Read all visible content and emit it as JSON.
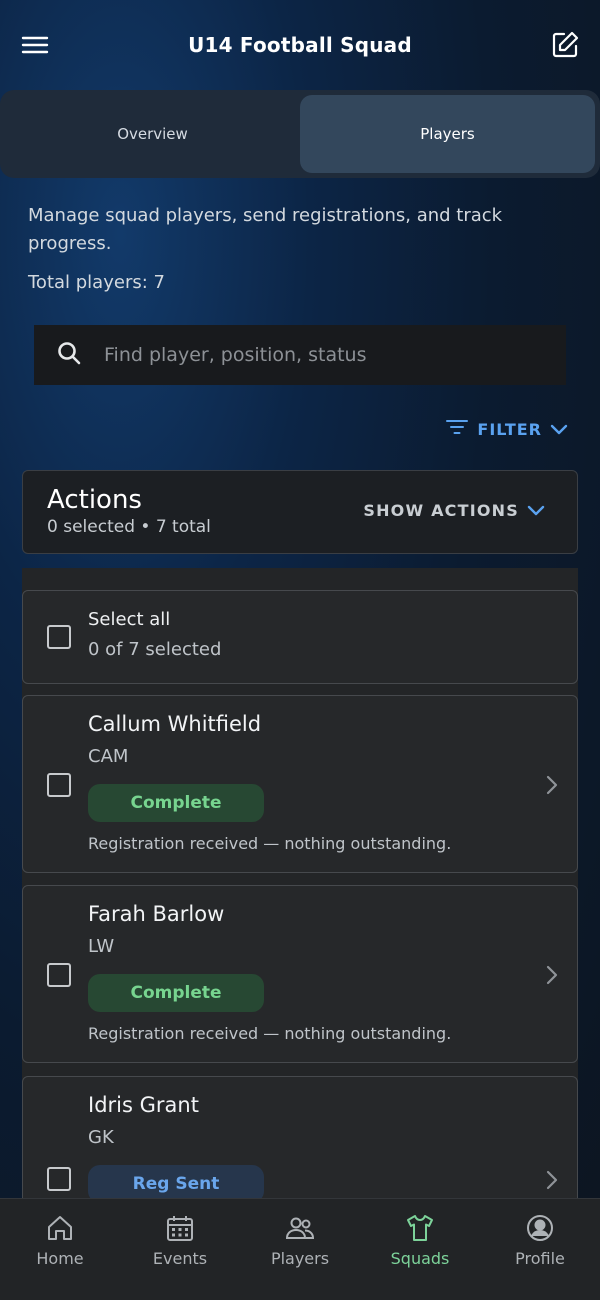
{
  "header": {
    "title": "U14 Football Squad",
    "menu_icon": "hamburger-menu-icon",
    "edit_icon": "edit-icon"
  },
  "tabs": [
    {
      "label": "Overview",
      "active": false
    },
    {
      "label": "Players",
      "active": true
    }
  ],
  "intro": {
    "description": "Manage squad players, send registrations, and track progress.",
    "total": "Total players: 7"
  },
  "search": {
    "placeholder": "Find player, position, status",
    "value": ""
  },
  "filter": {
    "label": "FILTER"
  },
  "actions": {
    "title": "Actions",
    "summary": "0 selected • 7 total",
    "toggle_label": "SHOW ACTIONS"
  },
  "select_all": {
    "label": "Select all",
    "summary": "0 of 7 selected",
    "checked": false
  },
  "players": [
    {
      "name": "Callum Whitfield",
      "position": "CAM",
      "status": "Complete",
      "status_type": "complete",
      "note": "Registration received — nothing outstanding."
    },
    {
      "name": "Farah Barlow",
      "position": "LW",
      "status": "Complete",
      "status_type": "complete",
      "note": "Registration received — nothing outstanding."
    },
    {
      "name": "Idris Grant",
      "position": "GK",
      "status": "Reg Sent",
      "status_type": "sent",
      "note": ""
    }
  ],
  "bottom_nav": [
    {
      "label": "Home",
      "icon": "home-icon",
      "active": false
    },
    {
      "label": "Events",
      "icon": "calendar-icon",
      "active": false
    },
    {
      "label": "Players",
      "icon": "people-icon",
      "active": false
    },
    {
      "label": "Squads",
      "icon": "shirt-icon",
      "active": true
    },
    {
      "label": "Profile",
      "icon": "profile-icon",
      "active": false
    }
  ],
  "colors": {
    "accent_blue": "#5aa2f0",
    "accent_green": "#7dd39a",
    "complete_bg": "#274833",
    "sent_bg": "#26364c"
  }
}
